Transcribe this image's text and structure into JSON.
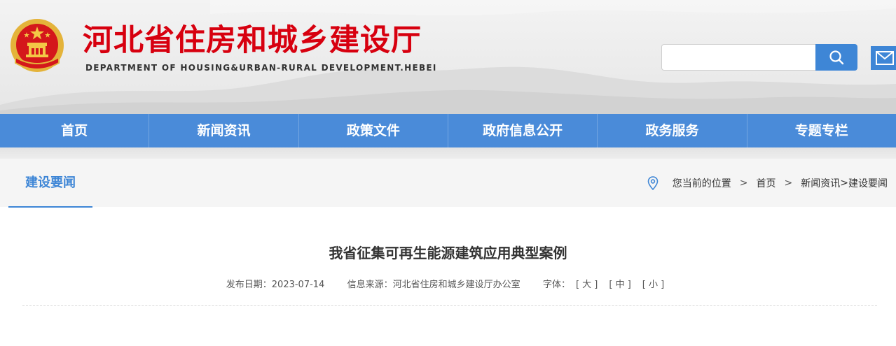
{
  "header": {
    "title": "河北省住房和城乡建设厅",
    "subtitle": "DEPARTMENT OF HOUSING&URBAN-RURAL DEVELOPMENT.HEBEI",
    "search": {
      "value": "",
      "placeholder": ""
    }
  },
  "nav": {
    "items": [
      "首页",
      "新闻资讯",
      "政策文件",
      "政府信息公开",
      "政务服务",
      "专题专栏"
    ]
  },
  "column": {
    "title": "建设要闻",
    "breadcrumb": {
      "prefix": "您当前的位置",
      "sep": ">",
      "home": "首页",
      "section": "新闻资讯",
      "inner_sep": ">",
      "current": "建设要闻"
    }
  },
  "article": {
    "title": "我省征集可再生能源建筑应用典型案例",
    "date_label": "发布日期：",
    "date": "2023-07-14",
    "source_label": "信息来源：",
    "source": "河北省住房和城乡建设厅办公室",
    "font_label": "字体：",
    "font_large": "[ 大 ]",
    "font_medium": "[ 中 ]",
    "font_small": "[ 小 ]"
  },
  "colors": {
    "brand_red": "#d7000f",
    "nav_blue": "#4a8bd9",
    "accent_blue": "#3e86d6"
  },
  "icons": [
    "national-emblem-icon",
    "search-icon",
    "mail-icon",
    "location-pin-icon"
  ]
}
